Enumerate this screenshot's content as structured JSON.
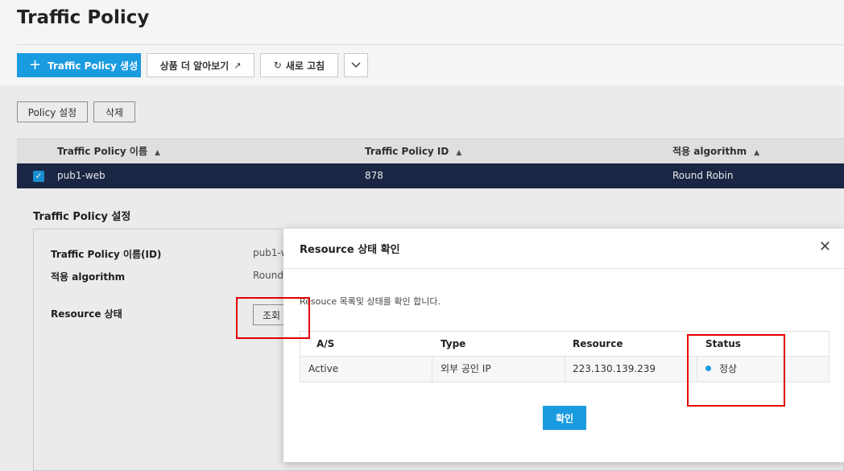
{
  "page": {
    "title": "Traffic Policy"
  },
  "toolbar": {
    "create_label": "Traffic Policy 생성",
    "learn_more_label": "상품 더 알아보기",
    "refresh_label": "새로 고침"
  },
  "sub_toolbar": {
    "policy_settings_label": "Policy 설정",
    "delete_label": "삭제"
  },
  "grid": {
    "columns": [
      "Traffic Policy 이름",
      "Traffic Policy ID",
      "적용 algorithm"
    ],
    "rows": [
      {
        "name": "pub1-web",
        "id": "878",
        "algorithm": "Round Robin"
      }
    ]
  },
  "settings": {
    "title": "Traffic Policy 설정",
    "fields": [
      {
        "label": "Traffic Policy 이름(ID)",
        "value": "pub1-w"
      },
      {
        "label": "적용 algorithm",
        "value": "Round I"
      },
      {
        "label": "Resource 상태",
        "button": "조회"
      }
    ]
  },
  "modal": {
    "title": "Resource 상태 확인",
    "description": "Resouce 목록및 상태를 확인 합니다.",
    "columns": [
      "A/S",
      "Type",
      "Resource",
      "Status"
    ],
    "rows": [
      {
        "as": "Active",
        "type": "외부 공인 IP",
        "resource": "223.130.139.239",
        "status": "정상"
      }
    ],
    "confirm_label": "확인",
    "status_color": "#1a9be0"
  },
  "colors": {
    "primary": "#1a9be0",
    "selected_row": "#1d2a4a",
    "annotation": "#e30000"
  }
}
